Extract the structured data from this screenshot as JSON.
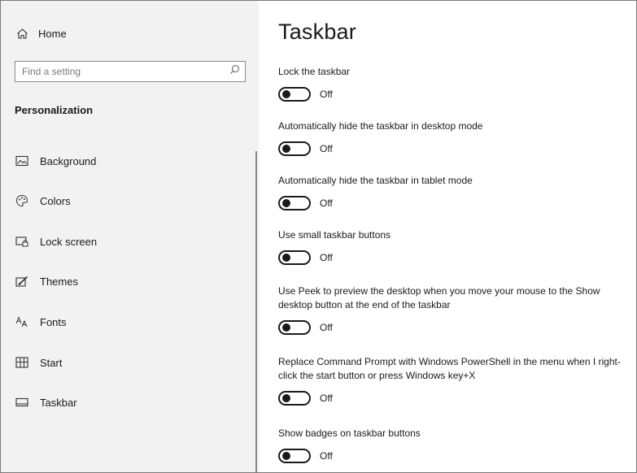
{
  "sidebar": {
    "home_label": "Home",
    "search_placeholder": "Find a setting",
    "section_title": "Personalization",
    "items": [
      {
        "label": "Background",
        "icon": "picture-icon"
      },
      {
        "label": "Colors",
        "icon": "palette-icon"
      },
      {
        "label": "Lock screen",
        "icon": "lock-screen-icon"
      },
      {
        "label": "Themes",
        "icon": "themes-brush-icon"
      },
      {
        "label": "Fonts",
        "icon": "fonts-icon"
      },
      {
        "label": "Start",
        "icon": "start-tiles-icon"
      },
      {
        "label": "Taskbar",
        "icon": "taskbar-icon"
      }
    ]
  },
  "page": {
    "title": "Taskbar"
  },
  "settings": [
    {
      "label": "Lock the taskbar",
      "state": "Off"
    },
    {
      "label": "Automatically hide the taskbar in desktop mode",
      "state": "Off"
    },
    {
      "label": "Automatically hide the taskbar in tablet mode",
      "state": "Off"
    },
    {
      "label": "Use small taskbar buttons",
      "state": "Off"
    },
    {
      "label": "Use Peek to preview the desktop when you move your mouse to the Show desktop button at the end of the taskbar",
      "state": "Off"
    },
    {
      "label": "Replace Command Prompt with Windows PowerShell in the menu when I right-click the start button or press Windows key+X",
      "state": "Off"
    },
    {
      "label": "Show badges on taskbar buttons",
      "state": "Off"
    }
  ]
}
